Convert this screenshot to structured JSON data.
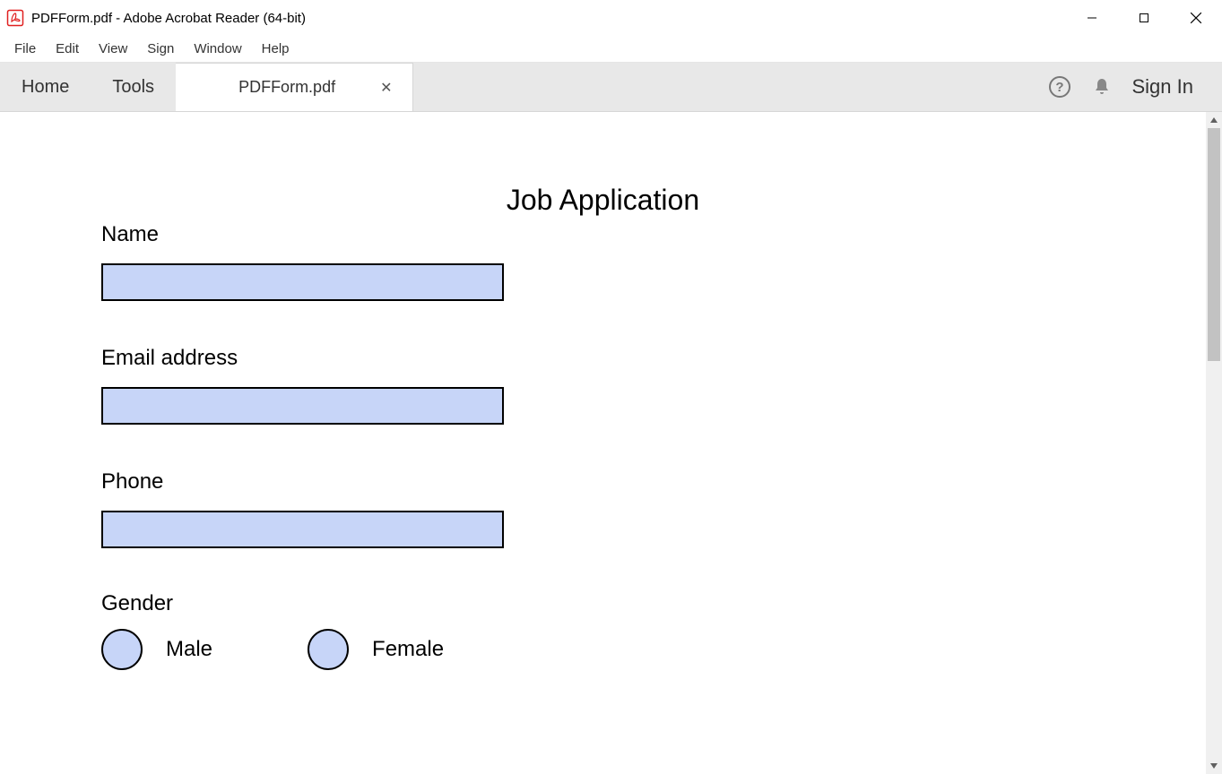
{
  "window": {
    "title": "PDFForm.pdf - Adobe Acrobat Reader (64-bit)"
  },
  "menu": {
    "items": [
      "File",
      "Edit",
      "View",
      "Sign",
      "Window",
      "Help"
    ]
  },
  "tabs": {
    "home": "Home",
    "tools": "Tools",
    "document": "PDFForm.pdf",
    "sign_in": "Sign In"
  },
  "form": {
    "title": "Job Application",
    "fields": {
      "name_label": "Name",
      "email_label": "Email address",
      "phone_label": "Phone",
      "gender_label": "Gender",
      "male_label": "Male",
      "female_label": "Female"
    },
    "values": {
      "name": "",
      "email": "",
      "phone": ""
    }
  }
}
